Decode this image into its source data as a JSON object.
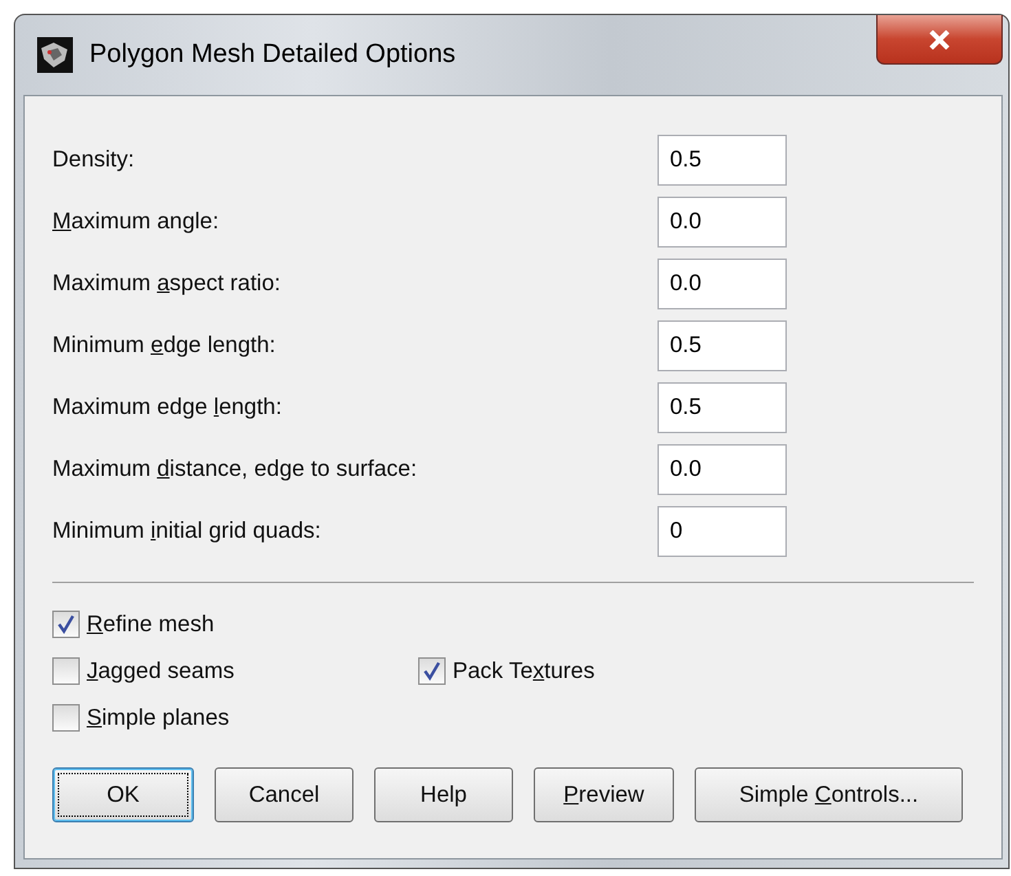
{
  "window": {
    "title": "Polygon Mesh Detailed Options"
  },
  "settings": [
    {
      "label": {
        "after": "Density:"
      },
      "value": "0.5"
    },
    {
      "label": {
        "key": "M",
        "after": "aximum angle:"
      },
      "value": "0.0"
    },
    {
      "label": {
        "before": "Maximum ",
        "key": "a",
        "after": "spect ratio:"
      },
      "value": "0.0"
    },
    {
      "label": {
        "before": "Minimum ",
        "key": "e",
        "after": "dge length:"
      },
      "value": "0.5"
    },
    {
      "label": {
        "before": "Maximum edge ",
        "key": "l",
        "after": "ength:"
      },
      "value": "0.5"
    },
    {
      "label": {
        "before": "Maximum ",
        "key": "d",
        "after": "istance, edge to surface:"
      },
      "value": "0.0"
    },
    {
      "label": {
        "before": "Minimum ",
        "key": "i",
        "after": "nitial grid quads:"
      },
      "value": "0"
    }
  ],
  "checkboxes": [
    {
      "label": {
        "key": "R",
        "after": "efine mesh"
      },
      "checked": true
    },
    {
      "label": {
        "key": "J",
        "after": "agged seams"
      },
      "checked": false
    },
    {
      "label": {
        "before": "Pack Te",
        "key": "x",
        "after": "tures"
      },
      "checked": true
    },
    {
      "label": {
        "key": "S",
        "after": "imple planes"
      },
      "checked": false
    }
  ],
  "buttons": [
    {
      "label": {
        "after": "OK"
      },
      "default": true
    },
    {
      "label": {
        "after": "Cancel"
      },
      "default": false
    },
    {
      "label": {
        "after": "Help"
      },
      "default": false
    },
    {
      "label": {
        "key": "P",
        "after": "review"
      },
      "default": false
    },
    {
      "label": {
        "before": "Simple ",
        "key": "C",
        "after": "ontrols..."
      },
      "default": false
    }
  ]
}
